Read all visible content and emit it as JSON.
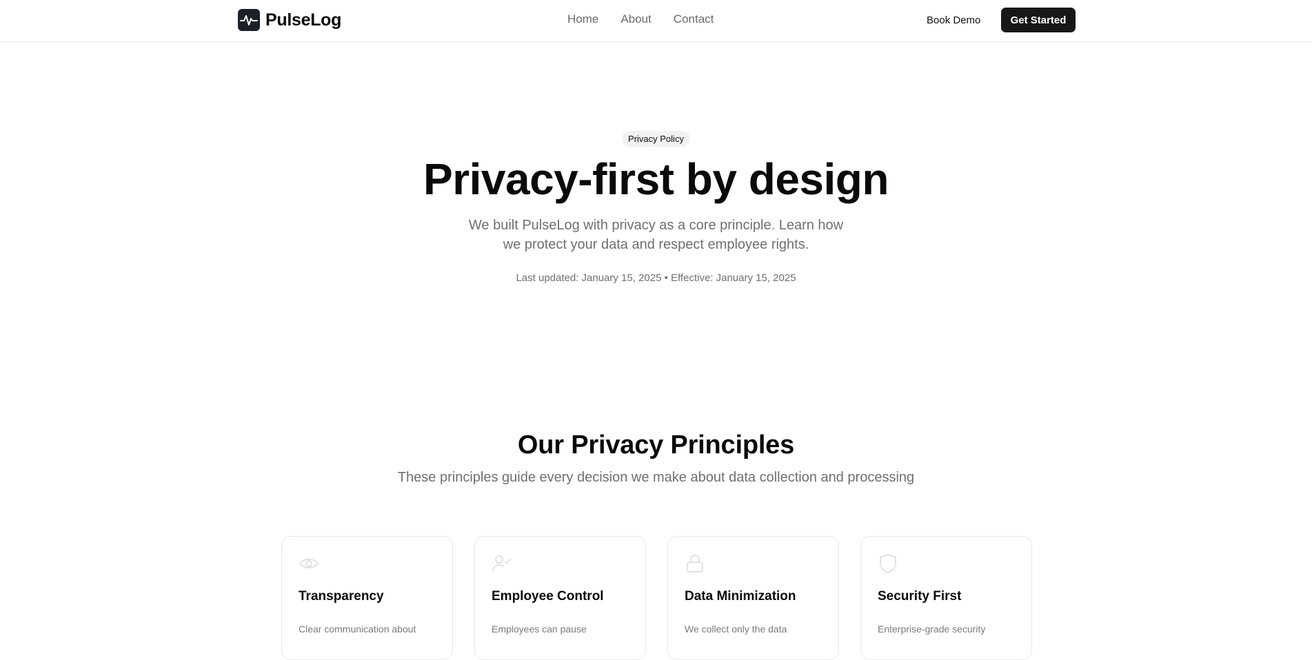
{
  "header": {
    "brand": "PulseLog",
    "nav": [
      "Home",
      "About",
      "Contact"
    ],
    "book_demo": "Book Demo",
    "get_started": "Get Started"
  },
  "hero": {
    "badge": "Privacy Policy",
    "title": "Privacy-first by design",
    "subtitle": "We built PulseLog with privacy as a core principle. Learn how we protect your data and respect employee rights.",
    "meta": "Last updated: January 15, 2025 • Effective: January 15, 2025"
  },
  "principles": {
    "title": "Our Privacy Principles",
    "subtitle": "These principles guide every decision we make about data collection and processing",
    "cards": [
      {
        "icon": "eye-icon",
        "title": "Transparency",
        "desc": "Clear communication about"
      },
      {
        "icon": "user-check-icon",
        "title": "Employee Control",
        "desc": "Employees can pause"
      },
      {
        "icon": "lock-icon",
        "title": "Data Minimization",
        "desc": "We collect only the data"
      },
      {
        "icon": "shield-icon",
        "title": "Security First",
        "desc": "Enterprise-grade security"
      }
    ]
  },
  "colors": {
    "primary_button": "#171717",
    "logo_bg": "#1c2128",
    "muted_text": "#6f6f6f",
    "icon_muted": "#e2e2e2"
  }
}
